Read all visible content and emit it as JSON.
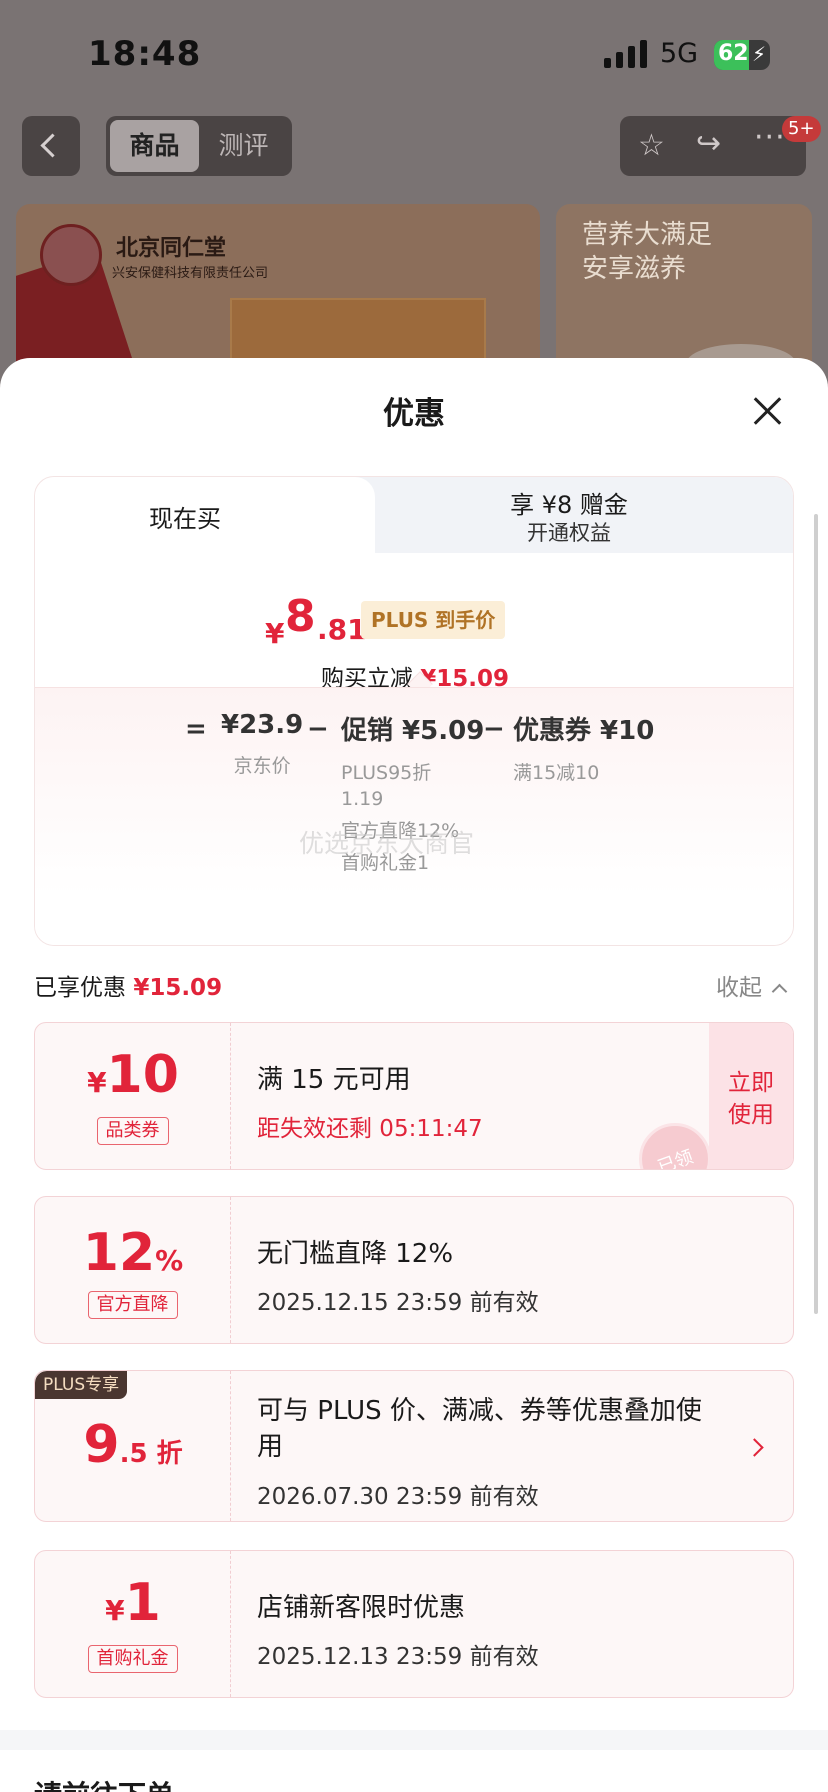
{
  "status_bar": {
    "time": "18:48",
    "network": "5G",
    "battery": "62",
    "battery_level": 0.62
  },
  "nav": {
    "tabs": [
      "商品",
      "测评"
    ],
    "badge": "5+"
  },
  "hero": {
    "brand": "北京同仁堂",
    "brand_sub": "兴安保健科技有限责任公司",
    "slogan": "营养大满足\n安享滋养"
  },
  "sheet": {
    "title": "优惠",
    "tabs": {
      "now": "现在买",
      "plus_line1": "享 ¥8 赠金",
      "plus_line2": "开通权益"
    },
    "price": {
      "yen": "¥",
      "int": "8",
      "dec": ".81",
      "plus_tag": "PLUS 到手价",
      "reduce_label": "购买立减",
      "reduce_value": "¥15.09"
    },
    "breakdown": {
      "eq": "=",
      "jd_price": "¥23.9",
      "jd_label": "京东价",
      "minus1": "−",
      "promo": "促销 ¥5.09",
      "promo_sub1": "PLUS95折",
      "promo_sub2": "1.19",
      "promo_sub3": "官方直降12%",
      "promo_sub4": "首购礼金1",
      "minus2": "−",
      "coupon": "优惠券 ¥10",
      "coupon_sub": "满15减10",
      "watermark": "优选京东大商官"
    },
    "enjoyed": {
      "label": "已享优惠",
      "value": "¥15.09",
      "collapse": "收起"
    },
    "coupons": [
      {
        "yen": "¥",
        "amount": "10",
        "tag": "品类券",
        "title": "满 15 元可用",
        "sub": "距失效还剩 05:11:47",
        "action": "立即\n使用",
        "stamp": "已领"
      },
      {
        "amount": "12",
        "unit": "%",
        "tag": "官方直降",
        "title": "无门槛直降 12%",
        "sub": "2025.12.15 23:59 前有效"
      },
      {
        "badge": "PLUS专享",
        "amount": "9",
        "unit": ".5 折",
        "title": "可与 PLUS 价、满减、券等优惠叠加使用",
        "sub": "2026.07.30 23:59 前有效"
      },
      {
        "yen": "¥",
        "amount": "1",
        "tag": "首购礼金",
        "title": "店铺新客限时优惠",
        "sub": "2025.12.13 23:59 前有效"
      }
    ],
    "footer": "请前往下单"
  }
}
